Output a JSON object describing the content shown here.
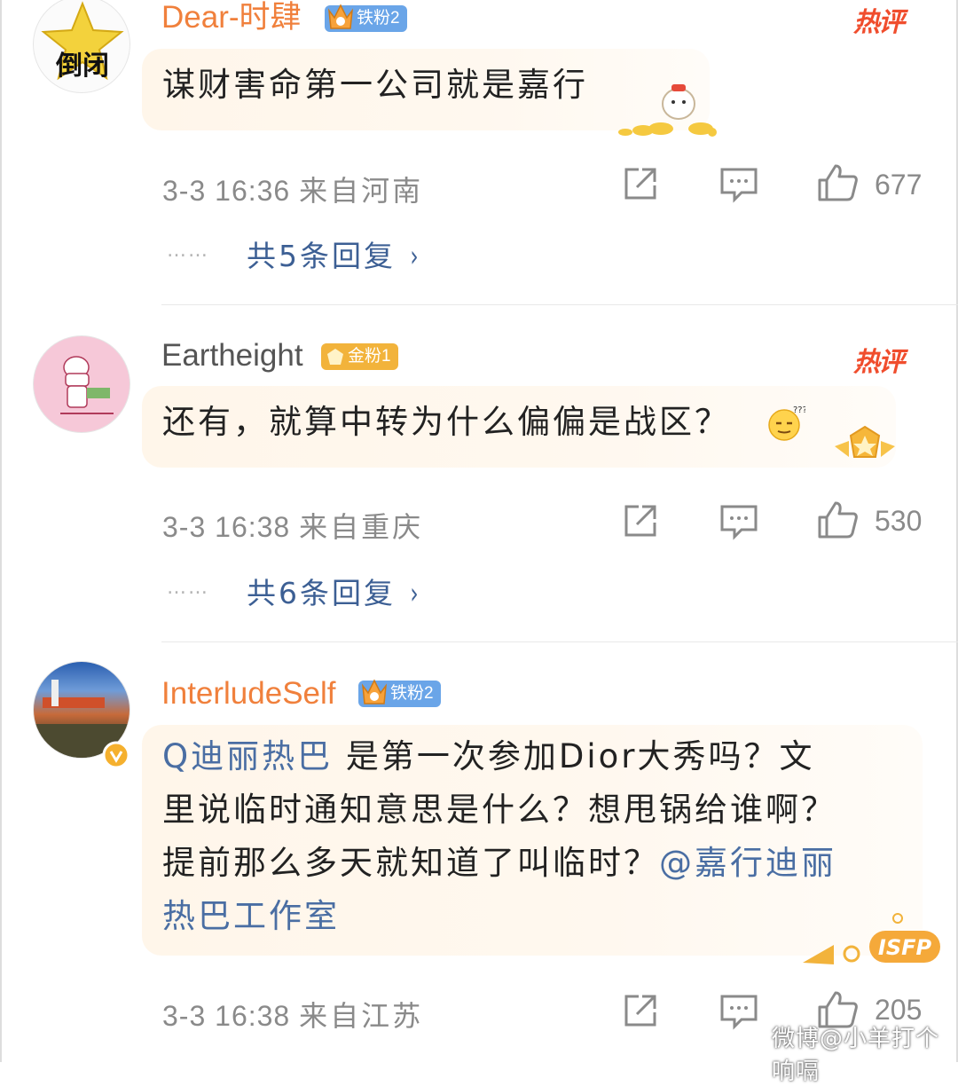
{
  "comments": [
    {
      "username": "Dear-时肆",
      "badge": "铁粉2",
      "hot_label": "热评",
      "avatar_text": "倒闭",
      "text": "谋财害命第一公司就是嘉行",
      "time": "3-3 16:36",
      "location": "来自河南",
      "likes": "677",
      "replies": "共5条回复",
      "dots": "……"
    },
    {
      "username": "Eartheight",
      "badge": "金粉1",
      "hot_label": "热评",
      "text": "还有，就算中转为什么偏偏是战区？",
      "time": "3-3 16:38",
      "location": "来自重庆",
      "likes": "530",
      "replies": "共6条回复",
      "dots": "……"
    },
    {
      "username": "InterludeSelf",
      "badge": "铁粉2",
      "text_mention_1": "Q迪丽热巴",
      "text_part_1": " 是第一次参加Dior大秀吗？文",
      "text_line_2": "里说临时通知意思是什么？想甩锅给谁啊？",
      "text_line_3": "提前那么多天就知道了叫临时？",
      "text_mention_2": "@嘉行迪丽",
      "text_mention_3": "热巴工作室",
      "deco_text": "ISFP",
      "time": "3-3 16:38",
      "location": "来自江苏",
      "likes": "205"
    }
  ],
  "watermark": "微博@小羊打个响嗝",
  "colors": {
    "username": "#f0803c",
    "mention": "#4a6ea3",
    "hot": "#f04d2d",
    "badge_blue": "#6aa5e8",
    "badge_gold": "#f2b33b"
  },
  "icons": [
    "share-icon",
    "comment-icon",
    "like-icon"
  ]
}
